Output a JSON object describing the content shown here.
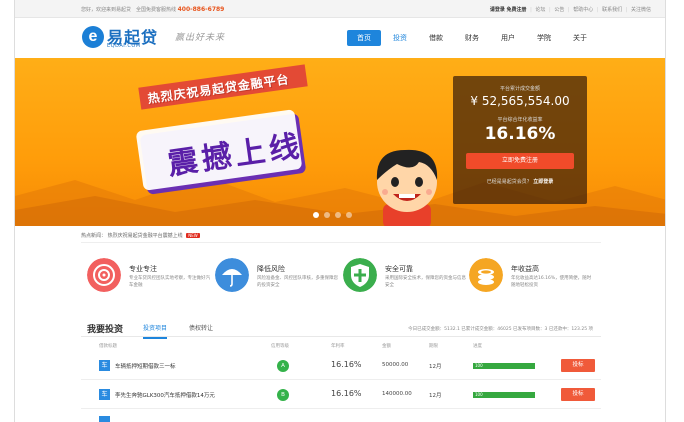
{
  "topbar": {
    "left_text": "您好，欢迎来到易起贷　全国免费客服热线",
    "phone": "400-886-6789",
    "login": "请登录",
    "register": "免费注册",
    "links": [
      "论坛",
      "公告",
      "帮助中心",
      "联系我们",
      "关注微信"
    ]
  },
  "header": {
    "logo_mark": "e",
    "logo_name": "易起贷",
    "logo_sub": "EQDAI.COM",
    "slogan": "赢出好未来",
    "nav": [
      "首页",
      "投资",
      "借款",
      "财务",
      "用户",
      "学院",
      "关于"
    ]
  },
  "banner": {
    "headline_small": "热烈庆祝易起贷金融平台",
    "headline_big": "震撼上线",
    "stats_label_1": "平台累计成交金额",
    "stats_value_1": "¥ 52,565,554.00",
    "stats_label_2": "平台综合年化收益率",
    "stats_value_2": "16.16%",
    "register_button": "立即免费注册",
    "login_prompt": "已经是易起贷会员？",
    "login_link": "立即登录"
  },
  "notice": {
    "label": "热点新闻：",
    "text": "热烈庆祝易起贷金融平台震撼上线",
    "badge": "NEW"
  },
  "features": [
    {
      "title": "专业专注",
      "desc": "专业车贷风控团队实地考察，专注做好汽车金融",
      "color": "#f2605f",
      "icon": "target-icon"
    },
    {
      "title": "降低风险",
      "desc": "风险准备金、风控团队审核，多重保障您的投资安全",
      "color": "#3d8ddc",
      "icon": "umbrella-icon"
    },
    {
      "title": "安全可靠",
      "desc": "采用国际安全技术，保障您的资金与信息安全",
      "color": "#3bae4d",
      "icon": "shield-cross-icon"
    },
    {
      "title": "年收益高",
      "desc": "年化收益高达16.16%，使用简便，随时随地轻松投资",
      "color": "#f5a623",
      "icon": "coins-icon"
    }
  ],
  "investment": {
    "title": "我要投资",
    "tabs": [
      "投资项目",
      "债权转让"
    ],
    "summary": "今日已成交金额：5132.1 已累计成交金额：46025 已发布项目数：3 已还款中：123.25 项",
    "headers": [
      "借款标题",
      "信用等级",
      "年利率",
      "金额",
      "期限",
      "进度"
    ],
    "rows": [
      {
        "tag": "车",
        "name": "车辆抵押短期借款三一标",
        "grade": "A",
        "rate": "16.16%",
        "amount": "50000.00",
        "term": "12月",
        "progress": "100",
        "progress_label": "100",
        "button": "投标"
      },
      {
        "tag": "车",
        "name": "李先生奔驰GLK300汽车抵押借款14万元",
        "grade": "B",
        "rate": "16.16%",
        "amount": "140000.00",
        "term": "12月",
        "progress": "100",
        "progress_label": "100",
        "button": "投标"
      }
    ]
  }
}
